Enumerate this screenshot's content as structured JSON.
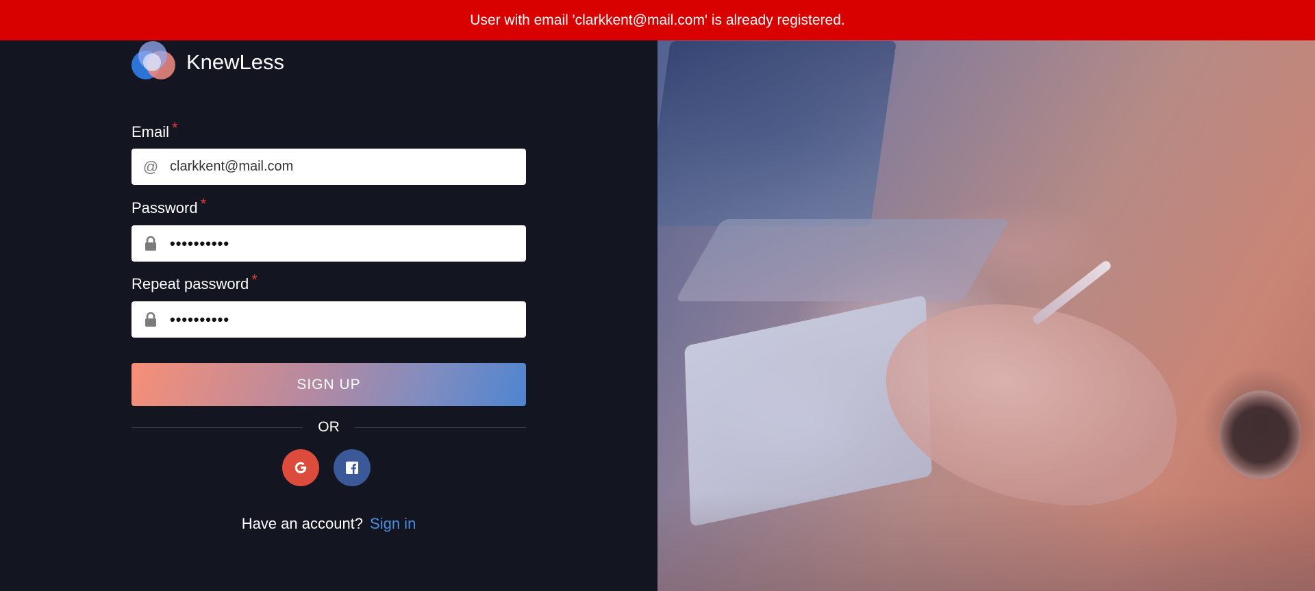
{
  "notification": {
    "message": "User with email 'clarkkent@mail.com' is already registered."
  },
  "brand": {
    "name": "KnewLess"
  },
  "form": {
    "email": {
      "label": "Email",
      "required_mark": "*",
      "value": "clarkkent@mail.com",
      "icon": "at-icon"
    },
    "password": {
      "label": "Password",
      "required_mark": "*",
      "masked_value": "••••••••••",
      "icon": "lock-icon"
    },
    "repeat_password": {
      "label": "Repeat password",
      "required_mark": "*",
      "masked_value": "••••••••••",
      "icon": "lock-icon"
    },
    "submit_label": "SIGN UP",
    "divider_text": "OR"
  },
  "social": [
    {
      "name": "Google",
      "icon": "google-icon",
      "color": "#dc4b3b"
    },
    {
      "name": "Facebook",
      "icon": "facebook-icon",
      "color": "#3b5998"
    }
  ],
  "footer": {
    "prompt": "Have an account?",
    "link_label": "Sign in"
  },
  "colors": {
    "banner": "#d90000",
    "background": "#131521",
    "link": "#4a8ee0",
    "required": "#e53935"
  }
}
